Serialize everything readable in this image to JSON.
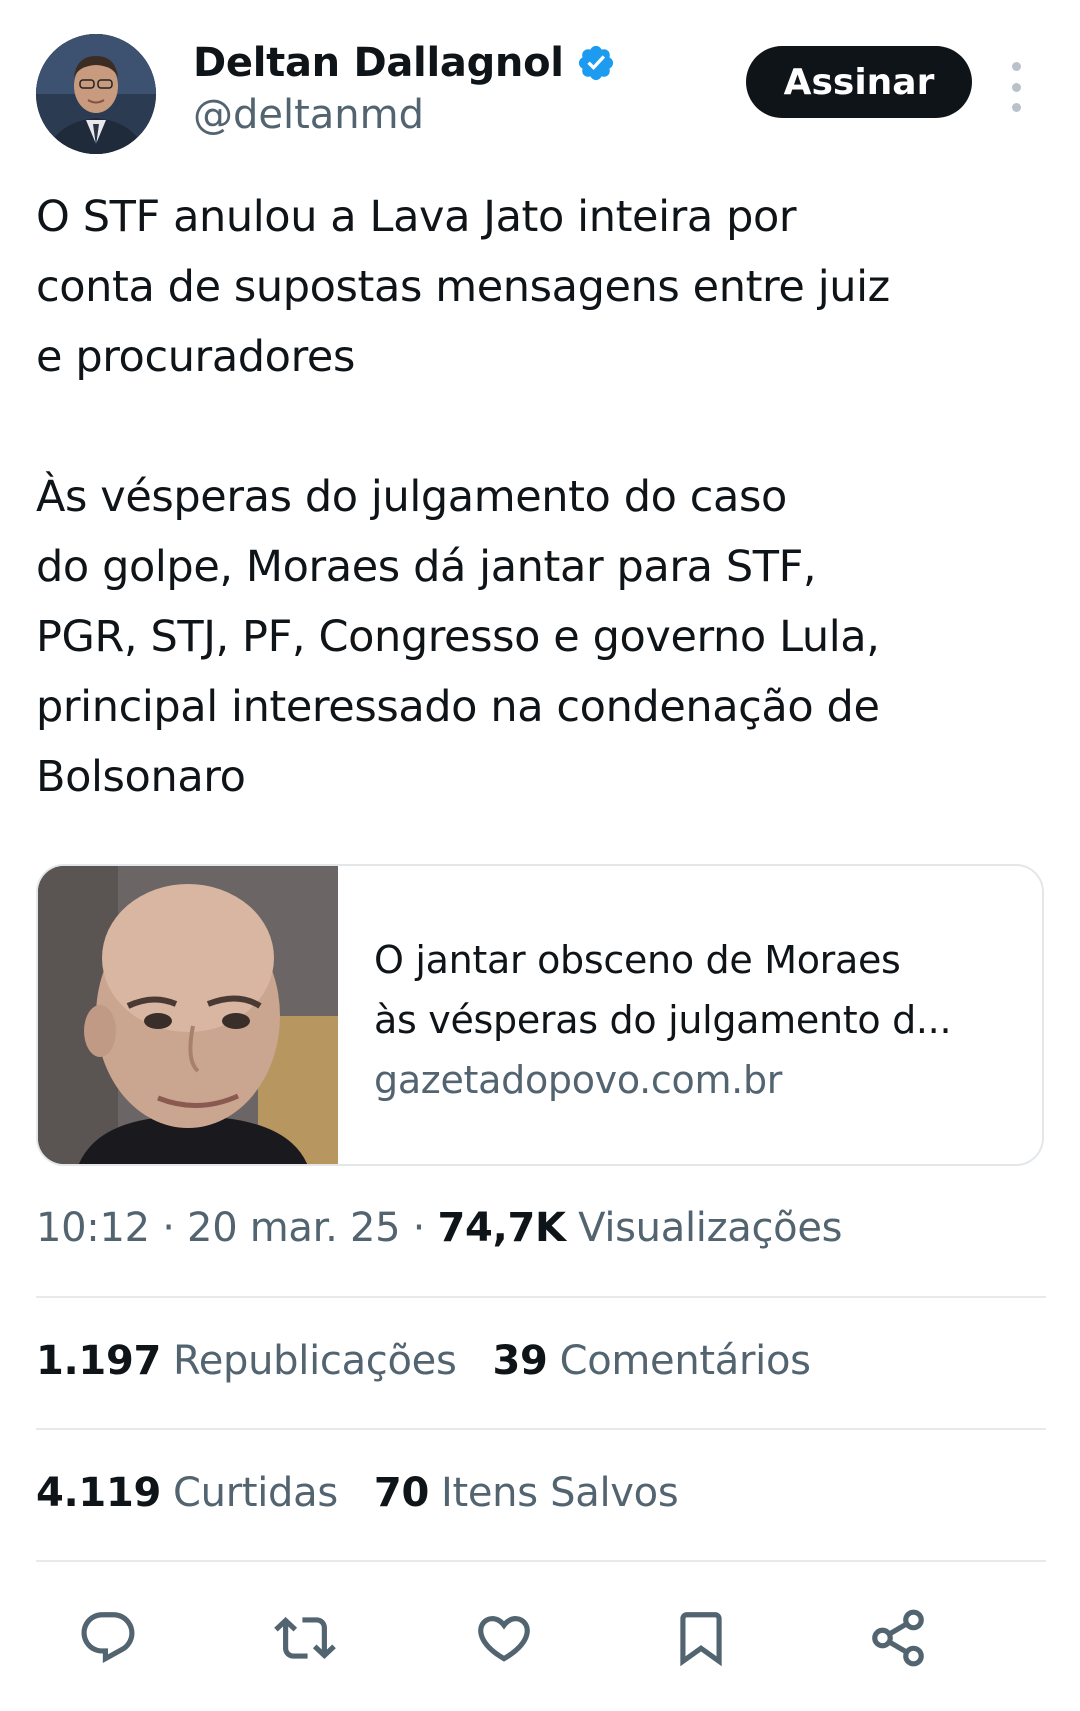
{
  "author": {
    "name": "Deltan Dallagnol",
    "handle": "@deltanmd",
    "verified_color": "#1d9bf0"
  },
  "header": {
    "subscribe_label": "Assinar",
    "more_icon": "more-vertical-icon"
  },
  "tweet": {
    "paragraph1": "O STF anulou a Lava Jato inteira por\nconta de supostas mensagens entre juiz\ne procuradores",
    "paragraph2": "Às vésperas do julgamento do caso\ndo golpe, Moraes dá jantar para STF,\nPGR, STJ, PF, Congresso e governo Lula,\nprincipal interessado na condenação de\nBolsonaro"
  },
  "link_card": {
    "title": "O jantar obsceno de Moraes\nàs vésperas do julgamento d...",
    "domain": "gazetadopovo.com.br"
  },
  "meta": {
    "time": "10:12",
    "date": "20 mar. 25",
    "views_count": "74,7K",
    "views_label": "Visualizações",
    "separator": "·"
  },
  "stats": {
    "reposts_count": "1.197",
    "reposts_label": "Republicações",
    "comments_count": "39",
    "comments_label": "Comentários",
    "likes_count": "4.119",
    "likes_label": "Curtidas",
    "saved_count": "70",
    "saved_label": "Itens Salvos"
  },
  "actions": [
    "reply-icon",
    "repost-icon",
    "like-icon",
    "bookmark-icon",
    "share-icon"
  ],
  "colors": {
    "text": "#0f1419",
    "muted": "#536471",
    "icon": "#536471",
    "verified": "#1d9bf0"
  }
}
